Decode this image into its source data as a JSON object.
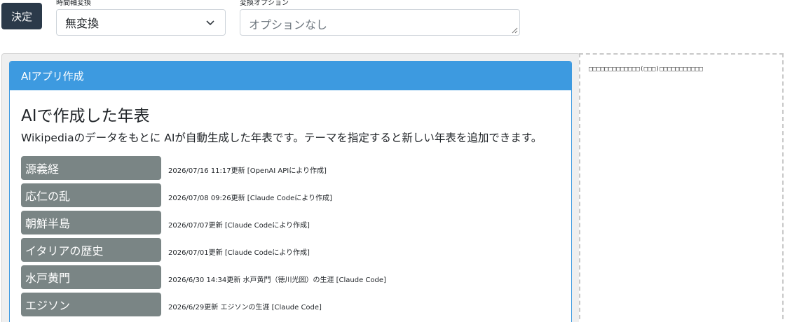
{
  "toolbar": {
    "submit_label": "決定",
    "time_axis_label": "時間軸変換",
    "time_axis_value": "無変換",
    "option_label": "変換オプション",
    "option_placeholder": "オプションなし"
  },
  "side_panel": {
    "text": "□□□□□□□□□□□□□(□□□)□□□□□□□□□□□"
  },
  "card": {
    "header": "AIアプリ作成",
    "title": "AIで作成した年表",
    "description": "Wikipediaのデータをもとに AIが自動生成した年表です。テーマを指定すると新しい年表を追加できます。",
    "items": [
      {
        "title": "源義経",
        "meta": "2026/07/16 11:17更新 [OpenAI APIにより作成]"
      },
      {
        "title": "応仁の乱",
        "meta": "2026/07/08 09:26更新 [Claude Codeにより作成]"
      },
      {
        "title": "朝鮮半島",
        "meta": "2026/07/07更新 [Claude Codeにより作成]"
      },
      {
        "title": "イタリアの歴史",
        "meta": "2026/07/01更新 [Claude Codeにより作成]"
      },
      {
        "title": "水戸黄門",
        "meta": "2026/6/30 14:34更新 水戸黄門（徳川光圀）の生涯 [Claude Code]"
      },
      {
        "title": "エジソン",
        "meta": "2026/6/29更新 エジソンの生涯 [Claude Code]"
      }
    ]
  },
  "colors": {
    "submit_bg": "#2b3a4a",
    "card_header_bg": "#3d9ae0",
    "topic_bg": "#7a8585"
  },
  "icons": {
    "select_chevron": "chevron-down-icon",
    "resize_grip": "resize-grip-icon"
  }
}
